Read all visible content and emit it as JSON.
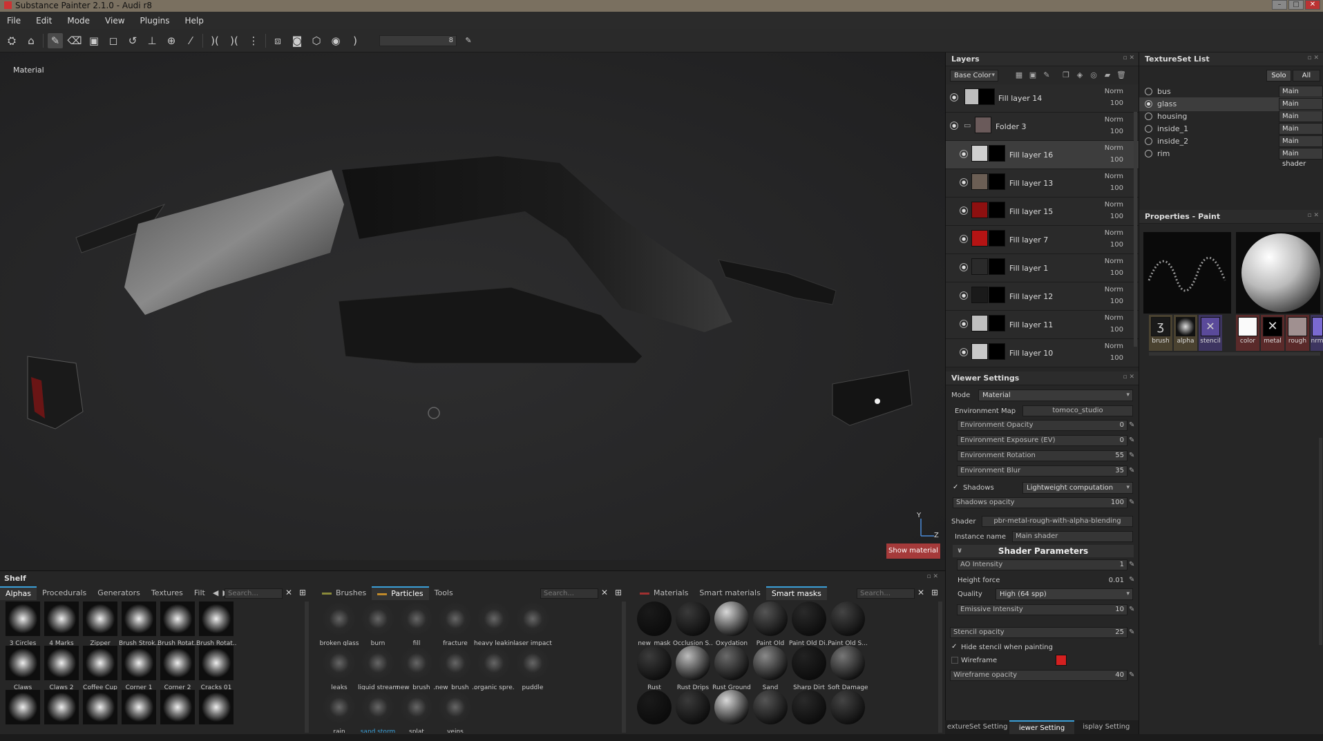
{
  "title": "Substance Painter 2.1.0 - Audi r8",
  "menu": [
    "File",
    "Edit",
    "Mode",
    "View",
    "Plugins",
    "Help"
  ],
  "toolbar": {
    "brush_size": "8"
  },
  "viewport": {
    "label": "Material",
    "show_material": "Show material",
    "axis_y": "Y",
    "axis_z": "Z"
  },
  "layers": {
    "title": "Layers",
    "channel": "Base Color",
    "items": [
      {
        "name": "Fill layer 14",
        "blend": "Norm",
        "opacity": "100",
        "color": "#bdbdbd"
      },
      {
        "name": "Folder 3",
        "blend": "Norm",
        "opacity": "100",
        "color": "#6a5a5a"
      },
      {
        "name": "Fill layer 16",
        "blend": "Norm",
        "opacity": "100",
        "color": "#cfcfcf"
      },
      {
        "name": "Fill layer 13",
        "blend": "Norm",
        "opacity": "100",
        "color": "#6b5e54"
      },
      {
        "name": "Fill layer 15",
        "blend": "Norm",
        "opacity": "100",
        "color": "#8e1010"
      },
      {
        "name": "Fill layer 7",
        "blend": "Norm",
        "opacity": "100",
        "color": "#b51414"
      },
      {
        "name": "Fill layer 1",
        "blend": "Norm",
        "opacity": "100",
        "color": "#2a2a2a"
      },
      {
        "name": "Fill layer 12",
        "blend": "Norm",
        "opacity": "100",
        "color": "#1a1a1a"
      },
      {
        "name": "Fill layer 11",
        "blend": "Norm",
        "opacity": "100",
        "color": "#bfbfbf"
      },
      {
        "name": "Fill layer 10",
        "blend": "Norm",
        "opacity": "100",
        "color": "#c8c8c8"
      }
    ]
  },
  "viewer": {
    "title": "Viewer Settings",
    "mode_label": "Mode",
    "mode": "Material",
    "env_map_label": "Environment Map",
    "env_map": "tomoco_studio",
    "env_opacity_label": "Environment Opacity",
    "env_opacity": "0",
    "env_exposure_label": "Environment Exposure (EV)",
    "env_exposure": "0",
    "env_rotation_label": "Environment Rotation",
    "env_rotation": "55",
    "env_blur_label": "Environment Blur",
    "env_blur": "35",
    "shadows_label": "Shadows",
    "shadows": "Lightweight computation",
    "shadows_opacity_label": "Shadows opacity",
    "shadows_opacity": "100",
    "shader_label": "Shader",
    "shader": "pbr-metal-rough-with-alpha-blending",
    "instance_label": "Instance name",
    "instance": "Main shader",
    "shader_params": "Shader Parameters",
    "ao_label": "AO Intensity",
    "ao": "1",
    "height_label": "Height force",
    "height": "0.01",
    "quality_label": "Quality",
    "quality": "High (64 spp)",
    "emissive_label": "Emissive Intensity",
    "emissive": "10",
    "stencil_label": "Stencil opacity",
    "stencil": "25",
    "hide_stencil": "Hide stencil when painting",
    "wireframe_label": "Wireframe",
    "wire_opacity_label": "Wireframe opacity",
    "wire_opacity": "40",
    "wire_color": "#d42020"
  },
  "bottom_tabs": [
    "extureSet Setting",
    "iewer Setting",
    "isplay Setting"
  ],
  "textureset": {
    "title": "TextureSet List",
    "solo": "Solo",
    "all": "All",
    "items": [
      {
        "name": "bus",
        "shader": "Main shader"
      },
      {
        "name": "glass",
        "shader": "Main shader"
      },
      {
        "name": "housing",
        "shader": "Main shader"
      },
      {
        "name": "inside_1",
        "shader": "Main shader"
      },
      {
        "name": "inside_2",
        "shader": "Main shader"
      },
      {
        "name": "rim",
        "shader": "Main shader"
      }
    ]
  },
  "properties": {
    "title": "Properties - Paint",
    "slots": [
      "brush",
      "alpha",
      "stencil"
    ],
    "mat_slots": [
      "color",
      "metal",
      "rough",
      "nrm"
    ]
  },
  "shelf": {
    "title": "Shelf",
    "left_tabs": [
      "Alphas",
      "Procedurals",
      "Generators",
      "Textures",
      "Filt"
    ],
    "search": "Search...",
    "alphas": [
      "3 Circles",
      "4 Marks",
      "Zipper",
      "Brush Strok...",
      "Brush Rotat...",
      "Brush Rotat...",
      "Claws",
      "Claws 2",
      "Coffee Cup",
      "Corner 1",
      "Corner 2",
      "Cracks 01",
      "",
      "",
      "",
      "",
      "",
      ""
    ],
    "mid_tabs": [
      "Brushes",
      "Particles",
      "Tools"
    ],
    "particles": [
      "broken glass",
      "burn",
      "fill",
      "fracture",
      "heavy leaking",
      "laser impact",
      "leaks",
      "liquid stream",
      "new_brush_...",
      "new_brush_...",
      "organic spre...",
      "puddle",
      "rain",
      "sand storm",
      "splat",
      "veins"
    ],
    "right_tabs": [
      "Materials",
      "Smart materials",
      "Smart masks"
    ],
    "masks": [
      "new_mask",
      "Occlusion S...",
      "Oxydation",
      "Paint Old",
      "Paint Old Di...",
      "Paint Old S...",
      "Rust",
      "Rust Drips",
      "Rust Ground",
      "Sand",
      "Sharp Dirt",
      "Soft Damages",
      "",
      "",
      "",
      "",
      "",
      ""
    ]
  }
}
